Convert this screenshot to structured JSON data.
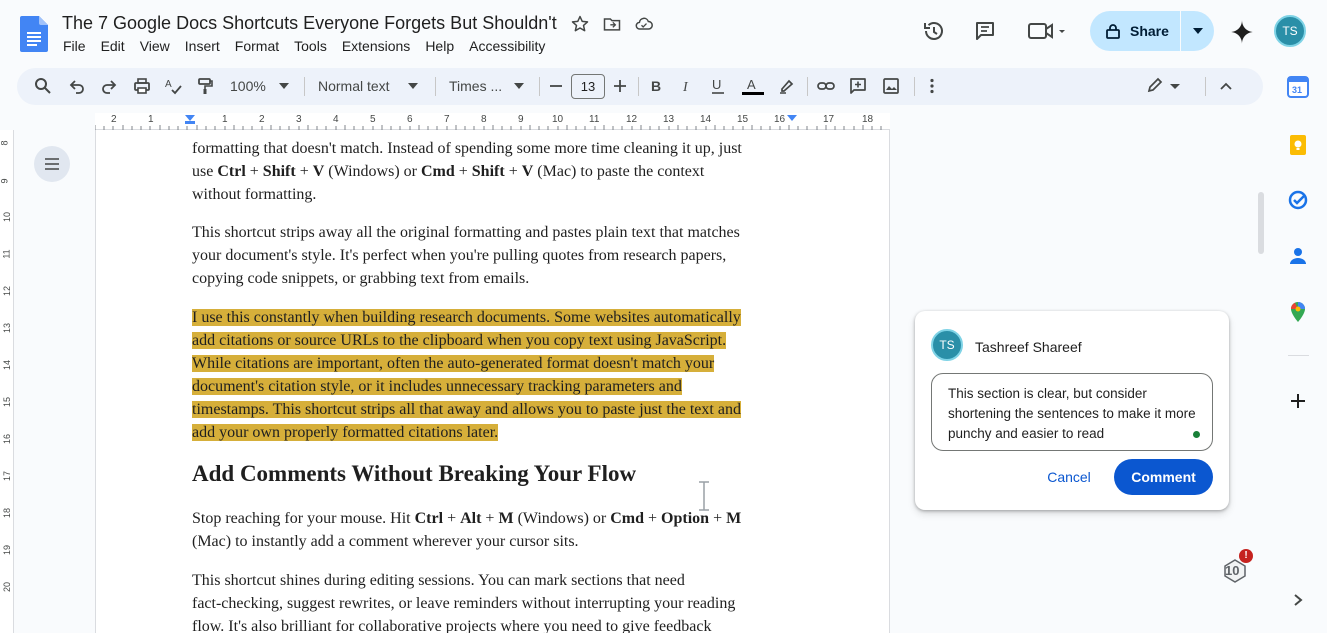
{
  "doc": {
    "title": "The 7 Google Docs Shortcuts Everyone Forgets But Shouldn't"
  },
  "menu": [
    "File",
    "Edit",
    "View",
    "Insert",
    "Format",
    "Tools",
    "Extensions",
    "Help",
    "Accessibility"
  ],
  "header": {
    "share_label": "Share",
    "avatar_initials": "TS"
  },
  "toolbar": {
    "zoom": "100%",
    "style": "Normal text",
    "font": "Times ...",
    "font_size": "13"
  },
  "ruler": {
    "h_numbers": [
      "2",
      "1",
      "1",
      "2",
      "3",
      "4",
      "5",
      "6",
      "7",
      "8",
      "9",
      "10",
      "11",
      "12",
      "13",
      "14",
      "15",
      "16",
      "17",
      "18"
    ],
    "v_numbers": [
      "8",
      "9",
      "10",
      "11",
      "12",
      "13",
      "14",
      "15",
      "16",
      "17",
      "18",
      "19",
      "20"
    ]
  },
  "content": {
    "p1_line1": "formatting that doesn't match. Instead of spending some more time cleaning it up, just",
    "p1_line2_a": "use ",
    "p1_line2_b": "Ctrl",
    "p1_line2_c": " + ",
    "p1_line2_d": "Shift",
    "p1_line2_e": " + ",
    "p1_line2_f": "V",
    "p1_line2_g": " (Windows) or ",
    "p1_line2_h": "Cmd",
    "p1_line2_i": " + ",
    "p1_line2_j": "Shift",
    "p1_line2_k": " + ",
    "p1_line2_l": "V",
    "p1_line2_m": " (Mac) to paste the context",
    "p1_line3": "without formatting.",
    "p2_line1": "This shortcut strips away all the original formatting and pastes plain text that matches",
    "p2_line2": "your document's style. It's perfect when you're pulling quotes from research papers,",
    "p2_line3": "copying code snippets, or grabbing text from emails.",
    "p3_line1": "I use this constantly when building research documents. Some websites automatically",
    "p3_line2": "add citations or source URLs to the clipboard when you copy text using JavaScript.",
    "p3_line3": "While citations are important, often the auto-generated format doesn't match your",
    "p3_line4": "document's citation style, or it includes unnecessary tracking parameters and",
    "p3_line5": "timestamps. This shortcut strips all that away and allows you to paste just the text and",
    "p3_line6": "add your own properly formatted citations later.",
    "heading": "Add Comments Without Breaking Your Flow",
    "p4_line1_a": "Stop reaching for your mouse. Hit ",
    "p4_line1_b": "Ctrl",
    "p4_line1_c": " + ",
    "p4_line1_d": "Alt",
    "p4_line1_e": " + ",
    "p4_line1_f": "M",
    "p4_line1_g": " (Windows) or ",
    "p4_line1_h": "Cmd",
    "p4_line1_i": " + ",
    "p4_line1_j": "Option",
    "p4_line1_k": " + ",
    "p4_line1_l": "M",
    "p4_line2": "(Mac) to instantly add a comment wherever your cursor sits.",
    "p5_line1": "This shortcut shines during editing sessions. You can mark sections that need",
    "p5_line2": "fact-checking, suggest rewrites, or leave reminders without interrupting your reading",
    "p5_line3": "flow. It's also brilliant for collaborative projects where you need to give feedback"
  },
  "comment": {
    "author": "Tashreef Shareef",
    "avatar_initials": "TS",
    "draft_text": "This section is clear, but consider shortening the sentences to make it more punchy and easier to read",
    "cancel_label": "Cancel",
    "submit_label": "Comment"
  },
  "badge": {
    "count": "10",
    "alert": "!"
  },
  "colors": {
    "highlight": "#d6af3a",
    "primary": "#0b57d0",
    "share_bg": "#c2e7ff",
    "toolbar_bg": "#edf2fa"
  }
}
